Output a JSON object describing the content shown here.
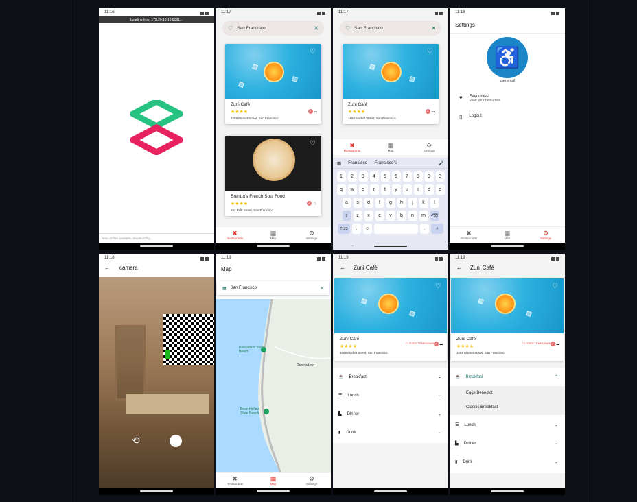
{
  "status": {
    "t1": "11:16",
    "t2": "11:17",
    "t3": "11:17",
    "t4": "11:18",
    "t5": "11:18",
    "t6": "11:19",
    "t7": "11:19",
    "t8": "11:19"
  },
  "loading": {
    "banner": "Loading from 172.20.10.13:8081...",
    "footer": "New update available, downloading..."
  },
  "search": {
    "value": "San Francisco"
  },
  "restaurants": [
    {
      "name": "Zuni Café",
      "address": "1658 Market Street, San Francisco",
      "rating": "★★★★"
    },
    {
      "name": "Brenda's French Soul Food",
      "address": "652 Polk Street, San Francisco",
      "rating": "★★★★"
    }
  ],
  "nav": {
    "restaurants": "Restaurants",
    "map": "Map",
    "settings": "Settings"
  },
  "keyboard": {
    "suggestions": [
      "Francisco",
      "Francisco's"
    ],
    "row_nums": [
      "1",
      "2",
      "3",
      "4",
      "5",
      "6",
      "7",
      "8",
      "9",
      "0"
    ],
    "row1": [
      "q",
      "w",
      "e",
      "r",
      "t",
      "y",
      "u",
      "i",
      "o",
      "p"
    ],
    "row2": [
      "a",
      "s",
      "d",
      "f",
      "g",
      "h",
      "j",
      "k",
      "l"
    ],
    "row3": [
      "z",
      "x",
      "c",
      "v",
      "b",
      "n",
      "m"
    ],
    "sym": "?123",
    "comma": ",",
    "period": "."
  },
  "settings": {
    "title": "Settings",
    "email": "user.email",
    "favourites": "Favourites",
    "favourites_sub": "View your favourites",
    "logout": "Logout"
  },
  "camera": {
    "title": "camera"
  },
  "map": {
    "title": "Map",
    "search": "San Francisco",
    "pins": [
      "Pescadero State Beach",
      "Bean Hollow State Beach"
    ],
    "town": "Pescadero"
  },
  "detail": {
    "title": "Zuni Café",
    "closed": "CLOSED TEMPORARILY",
    "menu": [
      "Breakfast",
      "Lunch",
      "Dinner",
      "Drink"
    ],
    "breakfast_items": [
      "Eggs Benedict",
      "Classic Breakfast"
    ]
  },
  "colors": {
    "accent": "#1a7a72",
    "active": "#e53935",
    "star": "#f2c200"
  }
}
